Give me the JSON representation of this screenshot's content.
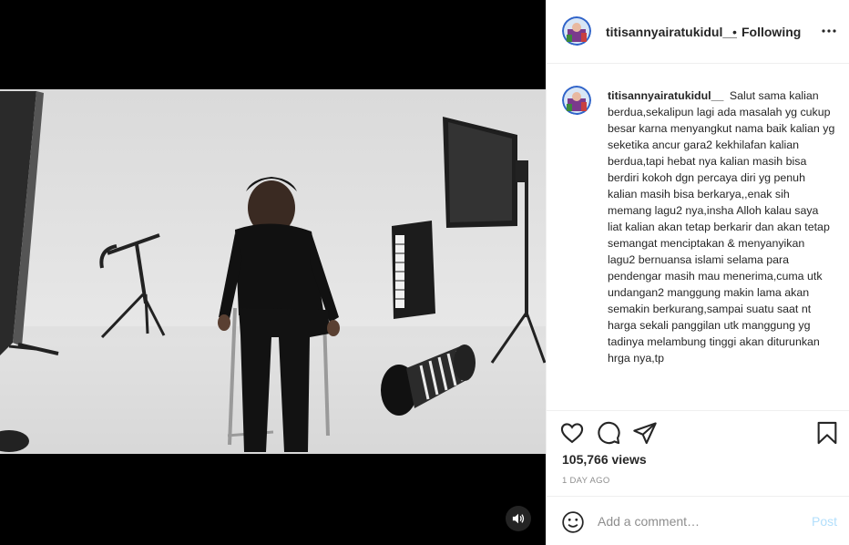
{
  "post": {
    "username": "titisannyairatukidul__",
    "separator": "•",
    "follow_status": "Following",
    "caption_user": "titisannyairatukidul__",
    "caption_text": "Salut sama kalian berdua,sekalipun lagi ada masalah yg cukup besar karna menyangkut nama baik kalian yg seketika ancur gara2 kekhilafan kalian berdua,tapi hebat nya kalian masih bisa berdiri kokoh dgn percaya diri yg penuh kalian masih bisa berkarya,,enak sih memang lagu2 nya,insha Alloh kalau saya liat kalian akan tetap berkarir dan akan tetap semangat menciptakan & menyanyikan lagu2 bernuansa islami selama para pendengar masih mau menerima,cuma utk undangan2 manggung makin lama akan semakin berkurang,sampai suatu saat nt harga sekali panggilan utk manggung yg tadinya melambung tinggi akan diturunkan hrga nya,tp",
    "views": "105,766 views",
    "time_ago": "1 DAY AGO"
  },
  "comment_box": {
    "placeholder": "Add a comment…",
    "post_label": "Post"
  },
  "icons": {
    "more": "more-options-icon",
    "like": "heart-icon",
    "comment": "comment-icon",
    "share": "share-icon",
    "save": "bookmark-icon",
    "emoji": "emoji-icon",
    "sound": "speaker-icon"
  },
  "colors": {
    "text": "#262626",
    "muted": "#8e8e8e",
    "post_disabled": "#b2dffc",
    "border": "#efefef"
  }
}
